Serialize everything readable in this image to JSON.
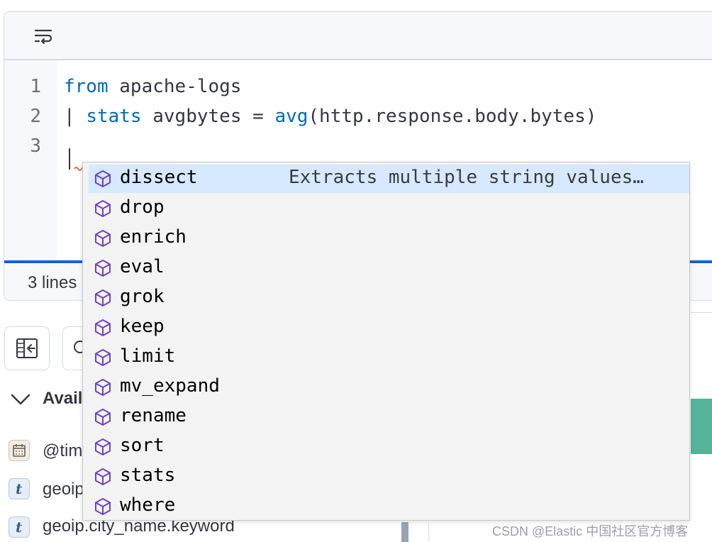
{
  "editor": {
    "line_numbers": [
      "1",
      "2",
      "3"
    ],
    "line1": {
      "kw": "from",
      "rest": " apache-logs"
    },
    "line2": {
      "pipe": "| ",
      "kw": "stats",
      "mid": " avgbytes = ",
      "fn": "avg",
      "rest": "(http.response.body.bytes)"
    },
    "line3": {
      "text": ""
    },
    "footer_text": "3 lines"
  },
  "suggestions": {
    "selected_detail": "Extracts multiple string values…",
    "items": [
      {
        "label": "dissect"
      },
      {
        "label": "drop"
      },
      {
        "label": "enrich"
      },
      {
        "label": "eval"
      },
      {
        "label": "grok"
      },
      {
        "label": "keep"
      },
      {
        "label": "limit"
      },
      {
        "label": "mv_expand"
      },
      {
        "label": "rename"
      },
      {
        "label": "sort"
      },
      {
        "label": "stats"
      },
      {
        "label": "where"
      }
    ]
  },
  "sidebar": {
    "available_label": "Avail",
    "fields": [
      {
        "label": "@tim",
        "type_icon": "calendar-icon"
      },
      {
        "label": "geoip",
        "type_icon": "text-type-icon"
      },
      {
        "label": "geoip.city_name.keyword",
        "type_icon": "text-type-icon"
      }
    ],
    "type_letter": "t"
  },
  "watermark": "CSDN @Elastic 中国社区官方博客",
  "colors": {
    "keyword": "#006bb8",
    "accent": "#0b64dd",
    "selected": "#d6e9ff",
    "icon_purple": "#6f42c1",
    "green": "#54b399"
  }
}
